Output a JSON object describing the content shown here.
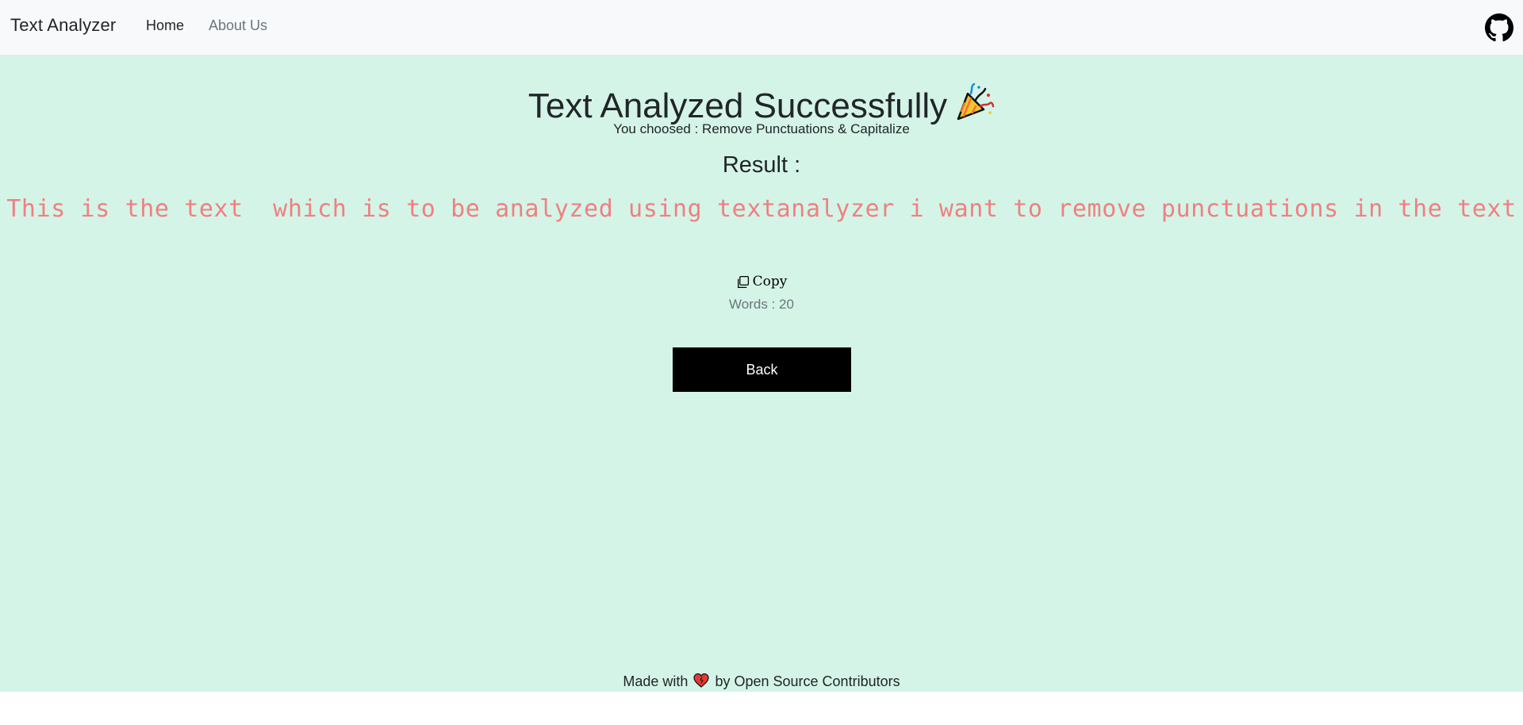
{
  "navbar": {
    "brand": "Text Analyzer",
    "links": [
      {
        "label": "Home"
      },
      {
        "label": "About Us"
      }
    ],
    "github_icon": "github-icon"
  },
  "main": {
    "title": "Text Analyzed Successfully",
    "title_icon": "party-popper-icon",
    "subtitle": "You choosed : Remove Punctuations & Capitalize",
    "result_label": "Result :",
    "result_text": "This is the text  which is to be analyzed using textanalyzer i want to remove punctuations in the text",
    "copy_label": "Copy",
    "copy_icon": "copy-icon",
    "words_label": "Words : 20",
    "back_label": "Back"
  },
  "footer": {
    "text_before": "Made with",
    "heart_icon": "heart-icon",
    "text_after": "by Open Source Contributors"
  },
  "colors": {
    "navbar_bg": "#f8f9fa",
    "page_bg": "#d4f4e7",
    "result_text": "#f08080",
    "button_bg": "#000000",
    "muted": "#6c757d"
  }
}
